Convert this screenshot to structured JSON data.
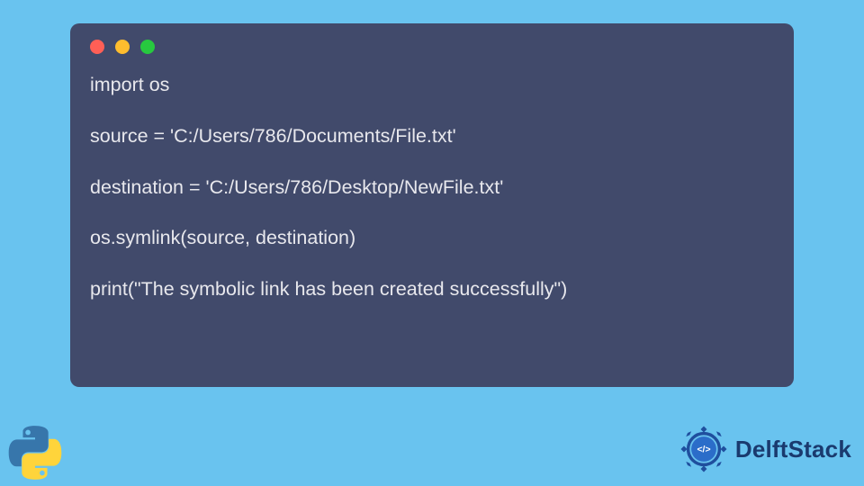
{
  "code": {
    "line1": "import os",
    "line2": "",
    "line3": "source = 'C:/Users/786/Documents/File.txt'",
    "line4": "",
    "line5": "destination = 'C:/Users/786/Desktop/NewFile.txt'",
    "line6": "",
    "line7": "os.symlink(source, destination)",
    "line8": "",
    "line9": "print(\"The symbolic link has been created successfully\")"
  },
  "brand": {
    "name": "DelftStack"
  }
}
